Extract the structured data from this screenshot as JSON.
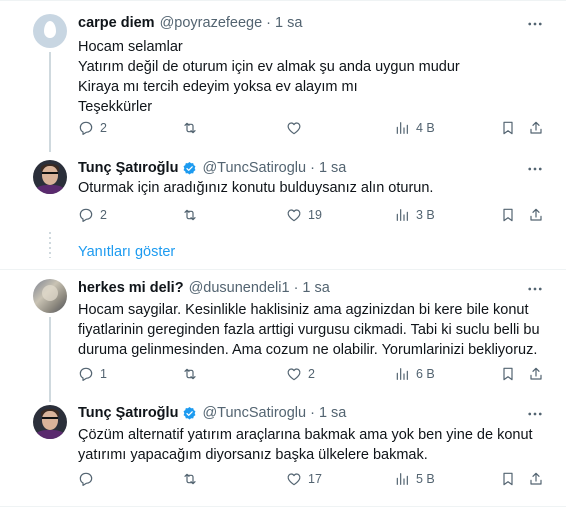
{
  "tweets": [
    {
      "name": "carpe diem",
      "handle": "@poyrazefeege",
      "dot": "·",
      "time": "1 sa",
      "verified": false,
      "lines": [
        "Hocam selamlar",
        "Yatırım değil de oturum için ev almak şu anda uygun mudur",
        "Kiraya mı tercih edeyim yoksa ev alayım mı",
        "Teşekkürler"
      ],
      "replies": "2",
      "retweets": "",
      "likes": "",
      "views": "4 B"
    },
    {
      "name": "Tunç Şatıroğlu",
      "handle": "@TuncSatiroglu",
      "dot": "·",
      "time": "1 sa",
      "verified": true,
      "lines": [
        "Oturmak için aradığınız konutu bulduysanız alın oturun."
      ],
      "replies": "2",
      "retweets": "",
      "likes": "19",
      "views": "3 B"
    },
    {
      "name": "herkes mi deli?",
      "handle": "@dusunendeli1",
      "dot": "·",
      "time": "1 sa",
      "verified": false,
      "lines": [
        "Hocam saygilar. Kesinlikle haklisiniz ama agzinizdan bi kere bile konut",
        "fiyatlarinin gereginden fazla arttigi vurgusu cikmadi. Tabi ki suclu belli bu",
        "duruma gelinmesinden. Ama cozum ne olabilir. Yorumlarinizi bekliyoruz."
      ],
      "replies": "1",
      "retweets": "",
      "likes": "2",
      "views": "6 B"
    },
    {
      "name": "Tunç Şatıroğlu",
      "handle": "@TuncSatiroglu",
      "dot": "·",
      "time": "1 sa",
      "verified": true,
      "lines": [
        "Çözüm alternatif yatırım araçlarına bakmak ama yok ben  yine de konut",
        "yatırımı yapacağım diyorsanız başka ülkelere bakmak."
      ],
      "replies": "",
      "retweets": "",
      "likes": "17",
      "views": "5 B"
    }
  ],
  "show_replies_label": "Yanıtları göster",
  "colors": {
    "text": "#0f1419",
    "secondary": "#536471",
    "accent": "#1d9bf0",
    "divider": "#eff3f4",
    "thread_line": "#cfd9de"
  },
  "icons": {
    "reply": "reply-icon",
    "retweet": "retweet-icon",
    "like": "heart-icon",
    "views": "views-icon",
    "bookmark": "bookmark-icon",
    "share": "share-icon",
    "more": "more-icon",
    "verified": "verified-badge-icon"
  }
}
